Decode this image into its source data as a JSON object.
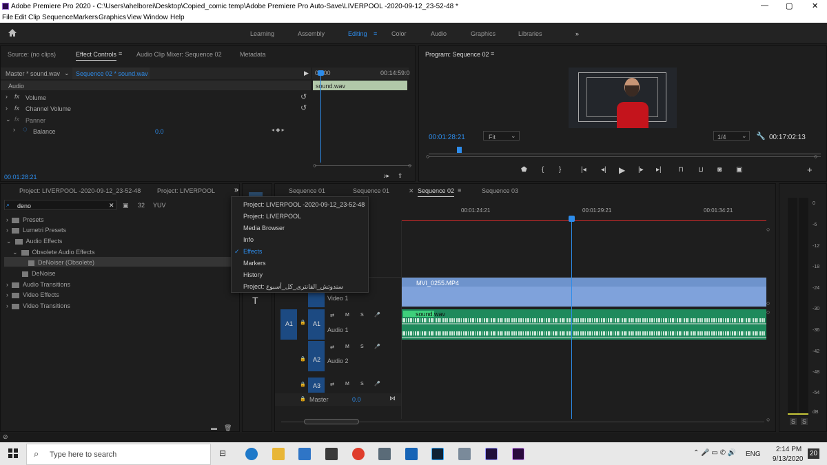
{
  "window": {
    "title": "Adobe Premiere Pro 2020 - C:\\Users\\ahelborei\\Desktop\\Copied_comic temp\\Adobe Premiere Pro Auto-Save\\LIVERPOOL -2020-09-12_23-52-48 *"
  },
  "menu": [
    "File",
    "Edit",
    "Clip",
    "Sequence",
    "Markers",
    "Graphics",
    "View",
    "Window",
    "Help"
  ],
  "workspaces": [
    "Learning",
    "Assembly",
    "Editing",
    "Color",
    "Audio",
    "Graphics",
    "Libraries"
  ],
  "source_panel": {
    "tabs": [
      "Source: (no clips)",
      "Effect Controls",
      "Audio Clip Mixer: Sequence 02",
      "Metadata"
    ],
    "master_label": "Master * sound.wav",
    "sequence_label": "Sequence 02 * sound.wav",
    "section": "Audio",
    "effects": [
      "Volume",
      "Channel Volume",
      "Panner"
    ],
    "balance_label": "Balance",
    "balance_value": "0.0",
    "clip_name": "sound.wav",
    "time_start": "00:00",
    "time_end": "00:14:59:0",
    "timecode": "00:01:28:21"
  },
  "program_panel": {
    "title": "Program: Sequence 02",
    "timecode": "00:01:28:21",
    "fit": "Fit",
    "quality": "1/4",
    "duration": "00:17:02:13"
  },
  "project_panel": {
    "tabs": [
      "Project: LIVERPOOL -2020-09-12_23-52-48",
      "Project: LIVERPOOL"
    ],
    "search": "deno",
    "tree": [
      {
        "label": "Presets",
        "indent": 0
      },
      {
        "label": "Lumetri Presets",
        "indent": 0
      },
      {
        "label": "Audio Effects",
        "indent": 0
      },
      {
        "label": "Obsolete Audio Effects",
        "indent": 1
      },
      {
        "label": "DeNoiser (Obsolete)",
        "indent": 2
      },
      {
        "label": "DeNoise",
        "indent": 1
      },
      {
        "label": "Audio Transitions",
        "indent": 0
      },
      {
        "label": "Video Effects",
        "indent": 0
      },
      {
        "label": "Video Transitions",
        "indent": 0
      }
    ]
  },
  "dropdown_menu": {
    "items": [
      "Project: LIVERPOOL -2020-09-12_23-52-48",
      "Project: LIVERPOOL",
      "Media Browser",
      "Info",
      "Effects",
      "Markers",
      "History",
      "Project: سندوتش_الفانترى_كل_أسبوع"
    ],
    "selected": "Effects"
  },
  "timeline": {
    "tabs": [
      "Sequence 01",
      "Sequence 01",
      "Sequence 02",
      "Sequence 03"
    ],
    "ruler": [
      "00:01:24:21",
      "00:01:29:21",
      "00:01:34:21"
    ],
    "video_track": "Video 1",
    "video_clip": "MVI_0255.MP4",
    "audio_clip": "sound.wav",
    "tracks": [
      {
        "name": "A1",
        "label": "Audio 1"
      },
      {
        "name": "A2",
        "label": "Audio 2"
      },
      {
        "name": "A3",
        "label": ""
      }
    ],
    "master_label": "Master",
    "master_value": "0.0",
    "track_buttons": [
      "M",
      "S"
    ]
  },
  "meter": {
    "labels": [
      "0",
      "-6",
      "-12",
      "-18",
      "-24",
      "-30",
      "-36",
      "-42",
      "-48",
      "-54",
      "dB"
    ],
    "solo": [
      "S",
      "S"
    ]
  },
  "taskbar": {
    "search_placeholder": "Type here to search",
    "time": "2:14 PM",
    "date": "9/13/2020",
    "lang": "ENG",
    "notif": "20"
  }
}
